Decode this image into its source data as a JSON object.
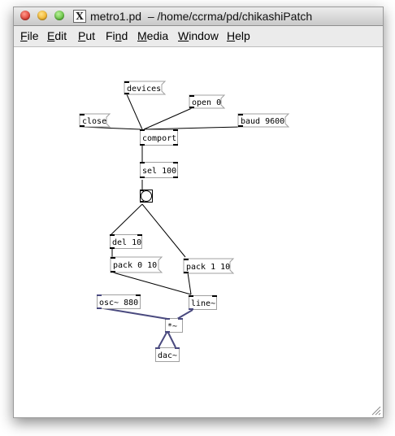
{
  "window": {
    "title": "metro1.pd  – /home/ccrma/pd/chikashiPatch"
  },
  "menubar": {
    "items": [
      {
        "pre": "",
        "ul": "F",
        "post": "ile"
      },
      {
        "pre": "",
        "ul": "E",
        "post": "dit"
      },
      {
        "pre": "",
        "ul": "P",
        "post": "ut"
      },
      {
        "pre": "Fi",
        "ul": "n",
        "post": "d"
      },
      {
        "pre": "",
        "ul": "M",
        "post": "edia"
      },
      {
        "pre": "",
        "ul": "W",
        "post": "indow"
      },
      {
        "pre": "",
        "ul": "H",
        "post": "elp"
      }
    ]
  },
  "patch": {
    "messages": {
      "devices": "devices",
      "open": "open 0",
      "close": "close",
      "baud": "baud 9600",
      "pack0": "pack 0 10",
      "pack1": "pack 1 10"
    },
    "objects": {
      "comport": "comport",
      "sel": "sel 100",
      "del": "del 10",
      "osc": "osc~ 880",
      "line": "line~",
      "mul": "*~",
      "dac": "dac~"
    },
    "colors": {
      "control_line": "#000000",
      "signal_line": "#4a4a7f",
      "box_border": "#a0a0a0",
      "inlet": "#000000"
    }
  }
}
